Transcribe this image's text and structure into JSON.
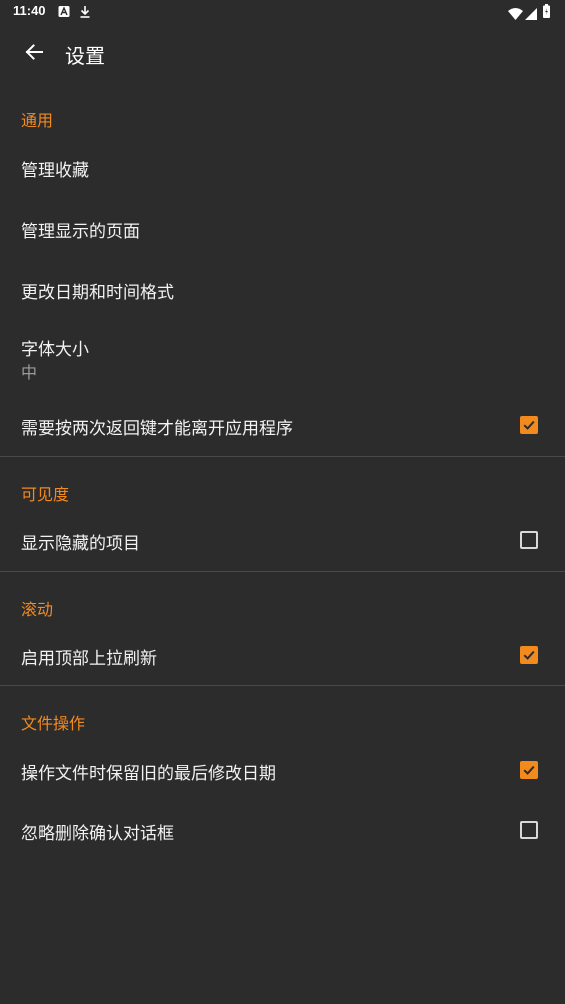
{
  "status_bar": {
    "time": "11:40",
    "icons": [
      "a-notification-icon",
      "download-icon",
      "wifi-icon",
      "signal-icon",
      "battery-icon"
    ]
  },
  "app_bar": {
    "title": "设置",
    "back_icon": "arrow-back-icon"
  },
  "colors": {
    "background": "#2d2c2d",
    "accent": "#f28a1e",
    "text": "#f2f2f2",
    "summary": "#9c9c9c",
    "divider": "#4a494a"
  },
  "sections": {
    "general": {
      "header": "通用",
      "manage_favorites": "管理收藏",
      "manage_visible_pages": "管理显示的页面",
      "date_time_format": "更改日期和时间格式",
      "font_size": "字体大小",
      "font_size_value": "中",
      "double_back_exit": "需要按两次返回键才能离开应用程序",
      "double_back_exit_checked": true
    },
    "visibility": {
      "header": "可见度",
      "show_hidden": "显示隐藏的项目",
      "show_hidden_checked": false
    },
    "scrolling": {
      "header": "滚动",
      "pull_to_refresh": "启用顶部上拉刷新",
      "pull_to_refresh_checked": true
    },
    "file_operations": {
      "header": "文件操作",
      "keep_last_modified": "操作文件时保留旧的最后修改日期",
      "keep_last_modified_checked": true,
      "skip_delete_confirm": "忽略删除确认对话框",
      "skip_delete_confirm_checked": false
    }
  }
}
